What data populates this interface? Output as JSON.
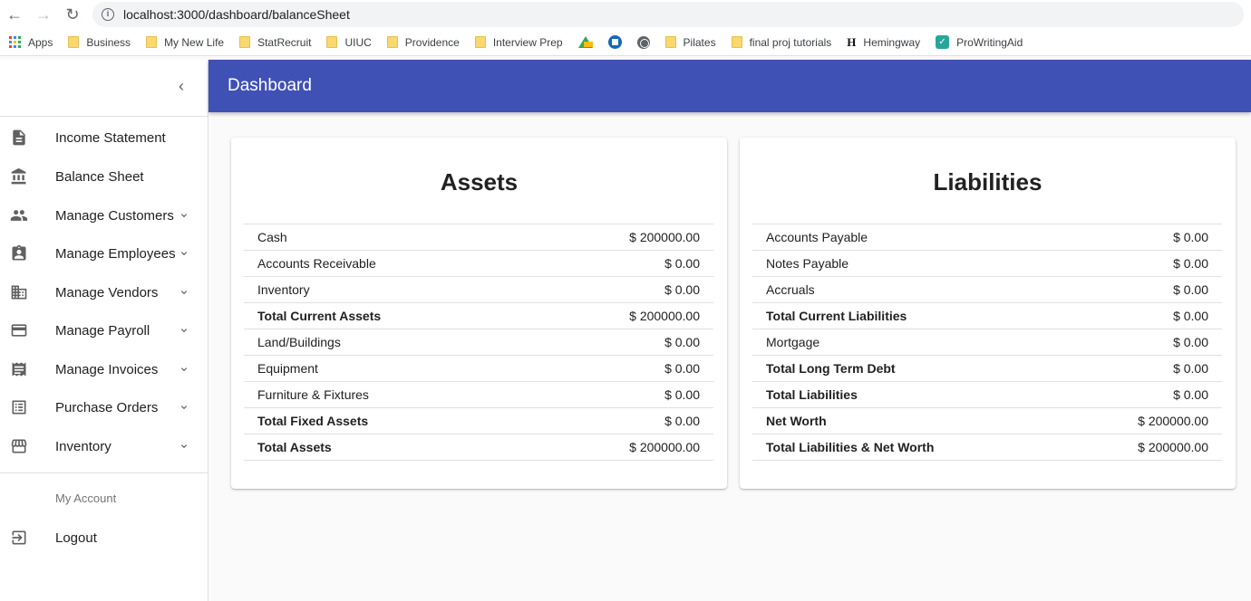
{
  "browser": {
    "url": "localhost:3000/dashboard/balanceSheet",
    "bookmarks": [
      {
        "label": "Apps",
        "icon": "apps-grid-icon"
      },
      {
        "label": "Business",
        "icon": "folder-icon"
      },
      {
        "label": "My New Life",
        "icon": "folder-icon"
      },
      {
        "label": "StatRecruit",
        "icon": "folder-icon"
      },
      {
        "label": "UIUC",
        "icon": "folder-icon"
      },
      {
        "label": "Providence",
        "icon": "folder-icon"
      },
      {
        "label": "Interview Prep",
        "icon": "folder-icon"
      },
      {
        "label": "",
        "icon": "google-drive-icon"
      },
      {
        "label": "",
        "icon": "chase-icon"
      },
      {
        "label": "",
        "icon": "globe-icon"
      },
      {
        "label": "Pilates",
        "icon": "folder-icon"
      },
      {
        "label": "final proj tutorials",
        "icon": "folder-icon"
      },
      {
        "label": "Hemingway",
        "icon": "hemingway-icon"
      },
      {
        "label": "ProWritingAid",
        "icon": "prowritingaid-icon"
      }
    ]
  },
  "sidebar": {
    "items": [
      {
        "label": "Income Statement",
        "icon": "document-icon",
        "expandable": false
      },
      {
        "label": "Balance Sheet",
        "icon": "bank-icon",
        "expandable": false
      },
      {
        "label": "Manage Customers",
        "icon": "people-icon",
        "expandable": true
      },
      {
        "label": "Manage Employees",
        "icon": "badge-icon",
        "expandable": true
      },
      {
        "label": "Manage Vendors",
        "icon": "business-icon",
        "expandable": true
      },
      {
        "label": "Manage Payroll",
        "icon": "credit-card-icon",
        "expandable": true
      },
      {
        "label": "Manage Invoices",
        "icon": "receipt-icon",
        "expandable": true
      },
      {
        "label": "Purchase Orders",
        "icon": "list-icon",
        "expandable": true
      },
      {
        "label": "Inventory",
        "icon": "store-icon",
        "expandable": true
      }
    ],
    "account_header": "My Account",
    "logout_label": "Logout"
  },
  "appbar": {
    "title": "Dashboard"
  },
  "assets": {
    "title": "Assets",
    "rows": [
      {
        "label": "Cash",
        "value": "$ 200000.00",
        "bold": false
      },
      {
        "label": "Accounts Receivable",
        "value": "$ 0.00",
        "bold": false
      },
      {
        "label": "Inventory",
        "value": "$ 0.00",
        "bold": false
      },
      {
        "label": "Total Current Assets",
        "value": "$ 200000.00",
        "bold": true
      },
      {
        "label": "Land/Buildings",
        "value": "$ 0.00",
        "bold": false
      },
      {
        "label": "Equipment",
        "value": "$ 0.00",
        "bold": false
      },
      {
        "label": "Furniture & Fixtures",
        "value": "$ 0.00",
        "bold": false
      },
      {
        "label": "Total Fixed Assets",
        "value": "$ 0.00",
        "bold": true
      },
      {
        "label": "Total Assets",
        "value": "$ 200000.00",
        "bold": true
      }
    ]
  },
  "liabilities": {
    "title": "Liabilities",
    "rows": [
      {
        "label": "Accounts Payable",
        "value": "$ 0.00",
        "bold": false
      },
      {
        "label": "Notes Payable",
        "value": "$ 0.00",
        "bold": false
      },
      {
        "label": "Accruals",
        "value": "$ 0.00",
        "bold": false
      },
      {
        "label": "Total Current Liabilities",
        "value": "$ 0.00",
        "bold": true
      },
      {
        "label": "Mortgage",
        "value": "$ 0.00",
        "bold": false
      },
      {
        "label": "Total Long Term Debt",
        "value": "$ 0.00",
        "bold": true
      },
      {
        "label": "Total Liabilities",
        "value": "$ 0.00",
        "bold": true
      },
      {
        "label": "Net Worth",
        "value": "$ 200000.00",
        "bold": true
      },
      {
        "label": "Total Liabilities & Net Worth",
        "value": "$ 200000.00",
        "bold": true
      }
    ]
  },
  "colors": {
    "appbar": "#3f51b5",
    "background": "#fafafa"
  }
}
